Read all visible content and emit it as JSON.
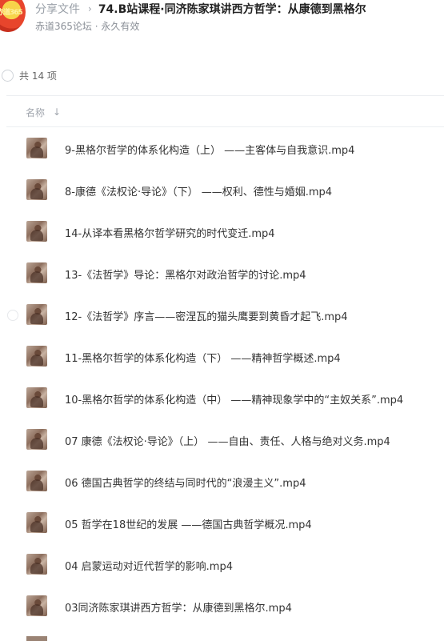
{
  "header": {
    "avatar_text": "赤道365",
    "crumb_parent": "分享文件",
    "crumb_separator": "›",
    "title": "74.B站课程·同济陈家琪讲西方哲学：从康德到黑格尔",
    "subtitle": "赤道365论坛 · 永久有效"
  },
  "summary": {
    "count_label": "共 14 项"
  },
  "columns": {
    "name_label": "名称",
    "sort_icon": "↓"
  },
  "files": [
    {
      "name": "9-黑格尔哲学的体系化构造（上） ——主客体与自我意识.mp4",
      "icon": "video-thumbnail-icon"
    },
    {
      "name": "8-康德《法权论·导论》（下） ——权利、德性与婚姻.mp4",
      "icon": "video-thumbnail-icon"
    },
    {
      "name": "14-从译本看黑格尔哲学研究的时代变迁.mp4",
      "icon": "video-thumbnail-icon"
    },
    {
      "name": "13-《法哲学》导论：黑格尔对政治哲学的讨论.mp4",
      "icon": "video-thumbnail-icon"
    },
    {
      "name": "12-《法哲学》序言——密涅瓦的猫头鹰要到黄昏才起飞.mp4",
      "icon": "video-thumbnail-icon"
    },
    {
      "name": "11-黑格尔哲学的体系化构造（下） ——精神哲学概述.mp4",
      "icon": "video-thumbnail-icon"
    },
    {
      "name": "10-黑格尔哲学的体系化构造（中） ——精神现象学中的“主奴关系”.mp4",
      "icon": "video-thumbnail-icon"
    },
    {
      "name": "07 康德《法权论·导论》（上） ——自由、责任、人格与绝对义务.mp4",
      "icon": "video-thumbnail-icon"
    },
    {
      "name": "06 德国古典哲学的终结与同时代的“浪漫主义”.mp4",
      "icon": "video-thumbnail-icon"
    },
    {
      "name": "05 哲学在18世纪的发展 ——德国古典哲学概况.mp4",
      "icon": "video-thumbnail-icon"
    },
    {
      "name": "04 启蒙运动对近代哲学的影响.mp4",
      "icon": "video-thumbnail-icon"
    },
    {
      "name": "03同济陈家琪讲西方哲学：从康德到黑格尔.mp4",
      "icon": "video-thumbnail-icon"
    }
  ]
}
